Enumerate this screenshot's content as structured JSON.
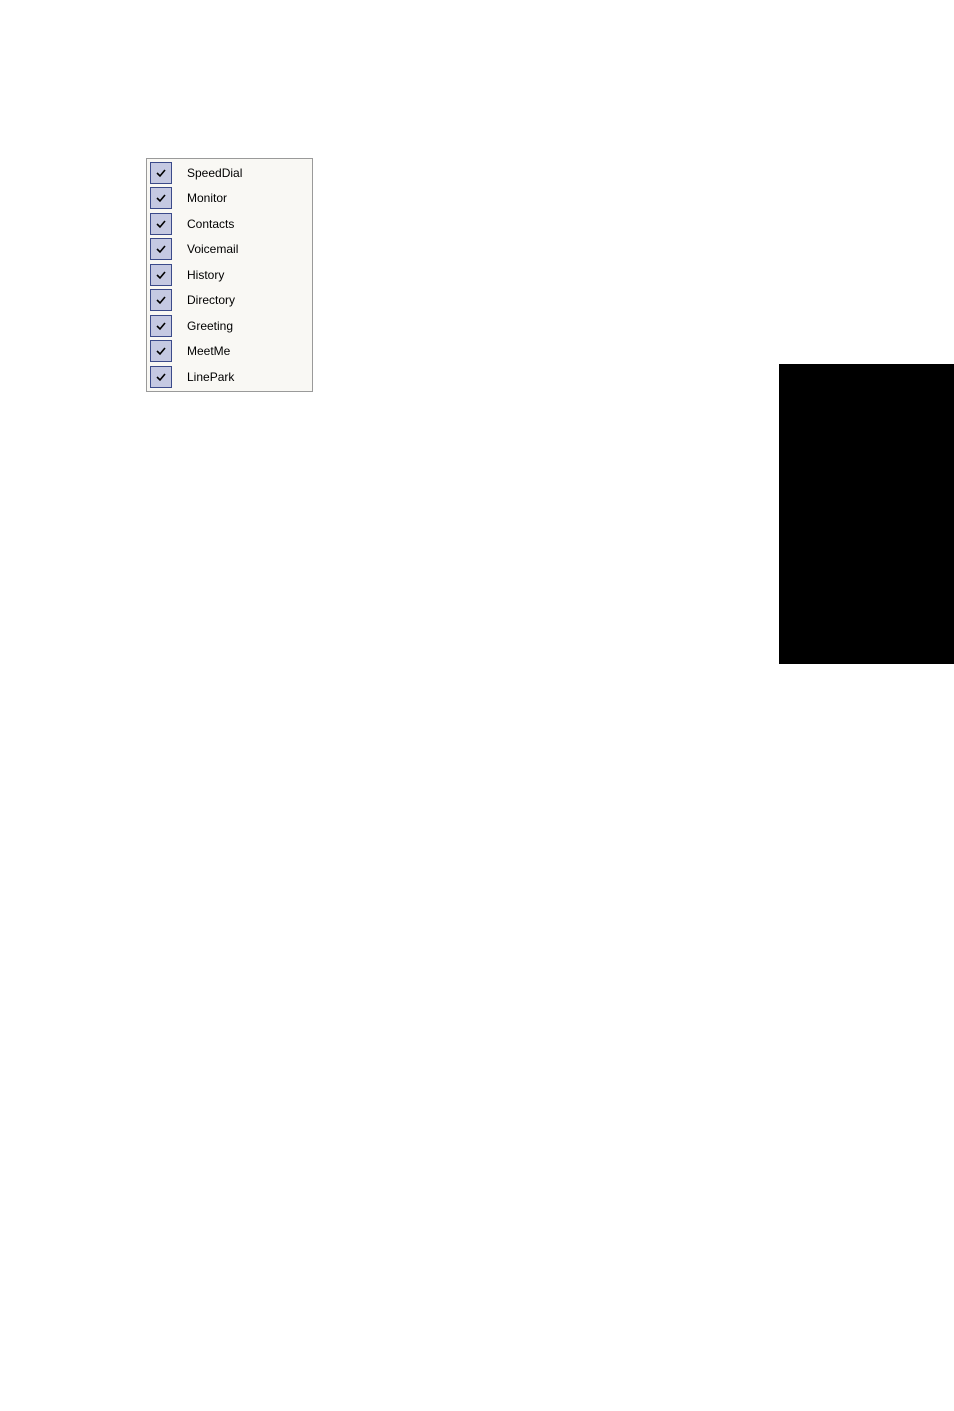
{
  "menu": {
    "items": [
      {
        "label": "SpeedDial",
        "checked": true,
        "name": "speeddial"
      },
      {
        "label": "Monitor",
        "checked": true,
        "name": "monitor"
      },
      {
        "label": "Contacts",
        "checked": true,
        "name": "contacts"
      },
      {
        "label": "Voicemail",
        "checked": true,
        "name": "voicemail"
      },
      {
        "label": "History",
        "checked": true,
        "name": "history"
      },
      {
        "label": "Directory",
        "checked": true,
        "name": "directory"
      },
      {
        "label": "Greeting",
        "checked": true,
        "name": "greeting"
      },
      {
        "label": "MeetMe",
        "checked": true,
        "name": "meetme"
      },
      {
        "label": "LinePark",
        "checked": true,
        "name": "linepark"
      }
    ]
  }
}
